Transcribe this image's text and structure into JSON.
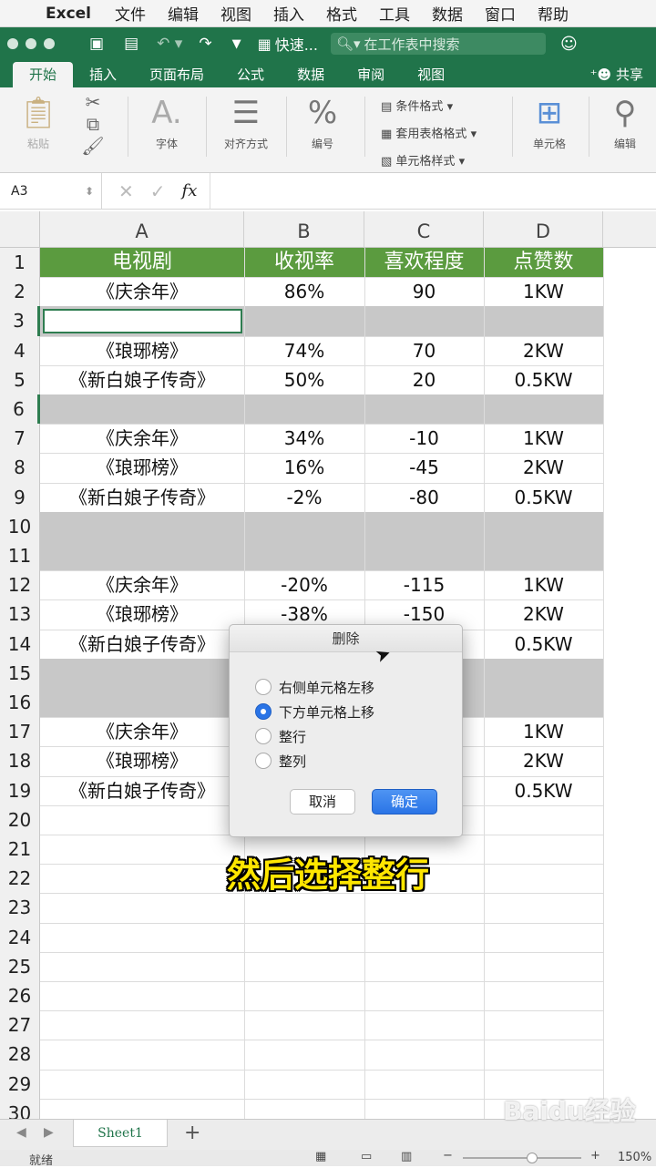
{
  "menubar": {
    "app": "Excel",
    "items": [
      "文件",
      "编辑",
      "视图",
      "插入",
      "格式",
      "工具",
      "数据",
      "窗口",
      "帮助"
    ]
  },
  "titlebar": {
    "quick": "快速...",
    "search_placeholder": "在工作表中搜索"
  },
  "tabs": [
    "开始",
    "插入",
    "页面布局",
    "公式",
    "数据",
    "审阅",
    "视图"
  ],
  "share": "共享",
  "ribbon": {
    "paste": "粘贴",
    "font": "字体",
    "align": "对齐方式",
    "number": "编号",
    "styles": [
      "条件格式",
      "套用表格格式",
      "单元格样式"
    ],
    "cells": "单元格",
    "edit": "编辑"
  },
  "formula_bar": {
    "name_box": "A3",
    "fx": "fx"
  },
  "columns": [
    "A",
    "B",
    "C",
    "D"
  ],
  "rows": [
    {
      "n": "1",
      "cells": [
        "电视剧",
        "收视率",
        "喜欢程度",
        "点赞数"
      ],
      "type": "header"
    },
    {
      "n": "2",
      "cells": [
        "《庆余年》",
        "86%",
        "90",
        "1KW"
      ],
      "type": "data"
    },
    {
      "n": "3",
      "cells": [
        "",
        "",
        "",
        ""
      ],
      "type": "gray"
    },
    {
      "n": "4",
      "cells": [
        "《琅琊榜》",
        "74%",
        "70",
        "2KW"
      ],
      "type": "data"
    },
    {
      "n": "5",
      "cells": [
        "《新白娘子传奇》",
        "50%",
        "20",
        "0.5KW"
      ],
      "type": "data"
    },
    {
      "n": "6",
      "cells": [
        "",
        "",
        "",
        ""
      ],
      "type": "gray"
    },
    {
      "n": "7",
      "cells": [
        "《庆余年》",
        "34%",
        "-10",
        "1KW"
      ],
      "type": "data"
    },
    {
      "n": "8",
      "cells": [
        "《琅琊榜》",
        "16%",
        "-45",
        "2KW"
      ],
      "type": "data"
    },
    {
      "n": "9",
      "cells": [
        "《新白娘子传奇》",
        "-2%",
        "-80",
        "0.5KW"
      ],
      "type": "data"
    },
    {
      "n": "10",
      "cells": [
        "",
        "",
        "",
        ""
      ],
      "type": "gray"
    },
    {
      "n": "11",
      "cells": [
        "",
        "",
        "",
        ""
      ],
      "type": "gray"
    },
    {
      "n": "12",
      "cells": [
        "《庆余年》",
        "-20%",
        "-115",
        "1KW"
      ],
      "type": "data"
    },
    {
      "n": "13",
      "cells": [
        "《琅琊榜》",
        "-38%",
        "-150",
        "2KW"
      ],
      "type": "data"
    },
    {
      "n": "14",
      "cells": [
        "《新白娘子传奇》",
        "",
        "",
        "0.5KW"
      ],
      "type": "data"
    },
    {
      "n": "15",
      "cells": [
        "",
        "",
        "",
        ""
      ],
      "type": "gray"
    },
    {
      "n": "16",
      "cells": [
        "",
        "",
        "",
        ""
      ],
      "type": "gray"
    },
    {
      "n": "17",
      "cells": [
        "《庆余年》",
        "",
        "",
        "1KW"
      ],
      "type": "data"
    },
    {
      "n": "18",
      "cells": [
        "《琅琊榜》",
        "",
        "",
        "2KW"
      ],
      "type": "data"
    },
    {
      "n": "19",
      "cells": [
        "《新白娘子传奇》",
        "",
        "",
        "0.5KW"
      ],
      "type": "data"
    },
    {
      "n": "20",
      "cells": [
        "",
        "",
        "",
        ""
      ],
      "type": "empty"
    },
    {
      "n": "21",
      "cells": [
        "",
        "",
        "",
        ""
      ],
      "type": "empty"
    },
    {
      "n": "22",
      "cells": [
        "",
        "",
        "",
        ""
      ],
      "type": "empty"
    },
    {
      "n": "23",
      "cells": [
        "",
        "",
        "",
        ""
      ],
      "type": "empty"
    },
    {
      "n": "24",
      "cells": [
        "",
        "",
        "",
        ""
      ],
      "type": "empty"
    },
    {
      "n": "25",
      "cells": [
        "",
        "",
        "",
        ""
      ],
      "type": "empty"
    },
    {
      "n": "26",
      "cells": [
        "",
        "",
        "",
        ""
      ],
      "type": "empty"
    },
    {
      "n": "27",
      "cells": [
        "",
        "",
        "",
        ""
      ],
      "type": "empty"
    },
    {
      "n": "28",
      "cells": [
        "",
        "",
        "",
        ""
      ],
      "type": "empty"
    },
    {
      "n": "29",
      "cells": [
        "",
        "",
        "",
        ""
      ],
      "type": "empty"
    },
    {
      "n": "30",
      "cells": [
        "",
        "",
        "",
        ""
      ],
      "type": "empty"
    }
  ],
  "dialog": {
    "title": "删除",
    "options": [
      "右侧单元格左移",
      "下方单元格上移",
      "整行",
      "整列"
    ],
    "selected_index": 1,
    "cancel": "取消",
    "ok": "确定"
  },
  "caption": "然后选择整行",
  "sheet_tab": "Sheet1",
  "status": {
    "text": "就绪",
    "zoom": "150%"
  },
  "watermark": "Baidu经验",
  "colors": {
    "excel_green": "#20744a",
    "header_fill": "#5b9b3f",
    "gray_row": "#c8c8c8",
    "accent_blue": "#2a74e6"
  }
}
